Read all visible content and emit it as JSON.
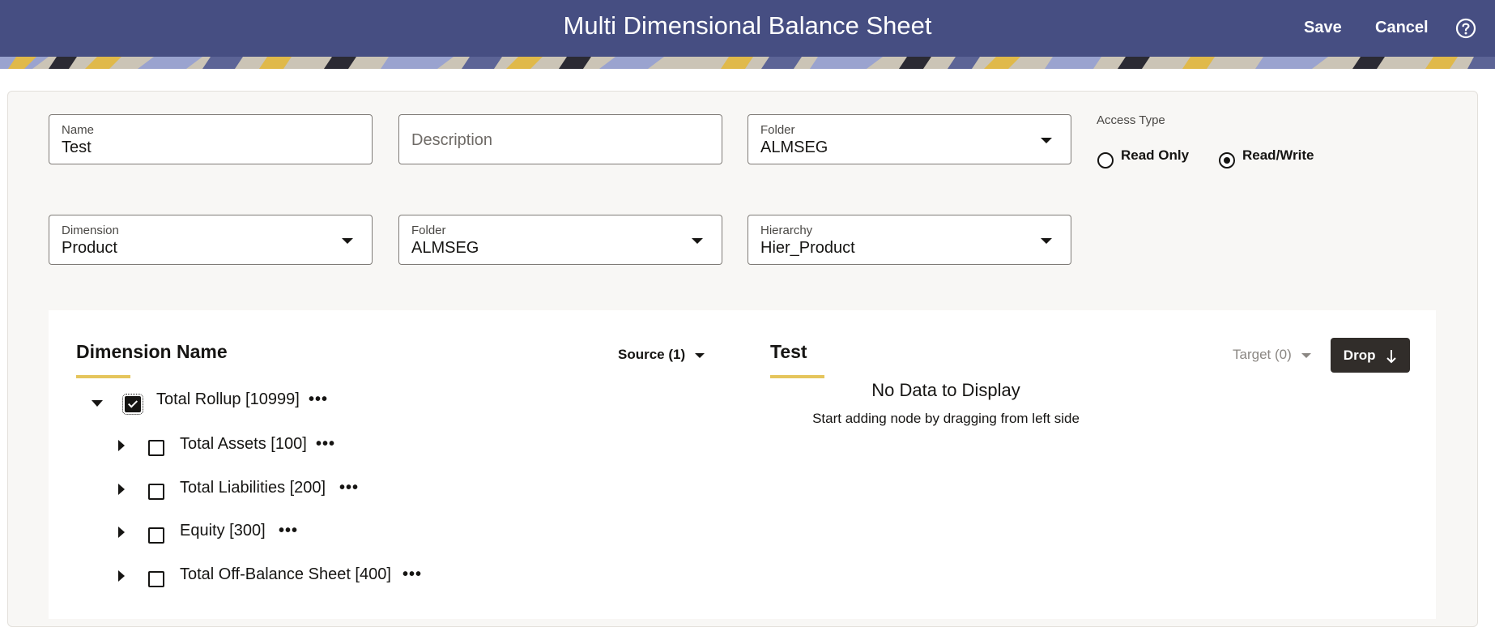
{
  "header": {
    "title": "Multi Dimensional Balance Sheet",
    "save_label": "Save",
    "cancel_label": "Cancel",
    "help_icon": "help-circle-icon",
    "background_color": "#464e82"
  },
  "form": {
    "name": {
      "label": "Name",
      "value": "Test"
    },
    "description": {
      "placeholder": "Description",
      "value": ""
    },
    "folder": {
      "label": "Folder",
      "value": "ALMSEG"
    },
    "access_type": {
      "label": "Access Type",
      "options": [
        {
          "label": "Read Only",
          "selected": false
        },
        {
          "label": "Read/Write",
          "selected": true
        }
      ]
    },
    "dimension": {
      "label": "Dimension",
      "value": "Product"
    },
    "dimension_folder": {
      "label": "Folder",
      "value": "ALMSEG"
    },
    "hierarchy": {
      "label": "Hierarchy",
      "value": "Hier_Product"
    }
  },
  "source": {
    "title": "Dimension Name",
    "menu_label": "Source (1)",
    "nodes": [
      {
        "label": "Total Rollup [10999]",
        "expanded": true,
        "checked": true,
        "level": 0
      },
      {
        "label": "Total Assets [100]",
        "expanded": false,
        "checked": false,
        "level": 1
      },
      {
        "label": "Total Liabilities [200]",
        "expanded": false,
        "checked": false,
        "level": 1
      },
      {
        "label": "Equity [300]",
        "expanded": false,
        "checked": false,
        "level": 1
      },
      {
        "label": "Total Off-Balance Sheet [400]",
        "expanded": false,
        "checked": false,
        "level": 1
      }
    ],
    "more_symbol": "•••"
  },
  "target": {
    "title": "Test",
    "menu_label": "Target (0)",
    "drop_label": "Drop",
    "drop_icon": "arrow-down-icon",
    "empty_title": "No Data to Display",
    "empty_message": "Start adding node by dragging from left side"
  },
  "colors": {
    "accent_underline": "#e5c55c",
    "drop_button": "#312d2a"
  }
}
